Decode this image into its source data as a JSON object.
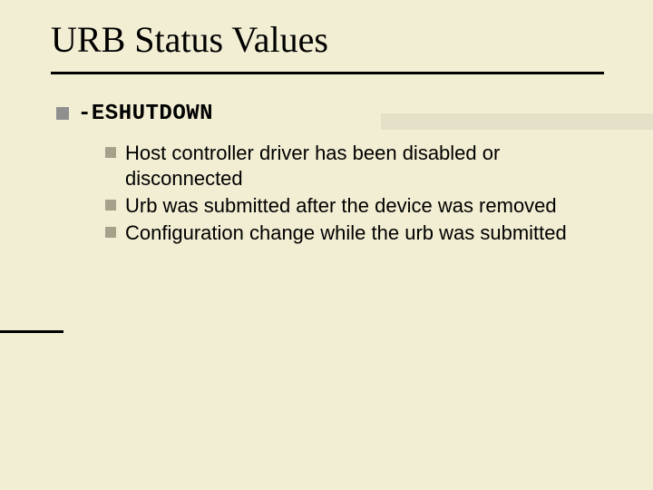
{
  "title": "URB Status Values",
  "status": {
    "code": "-ESHUTDOWN"
  },
  "items": [
    "Host controller driver has been disabled or disconnected",
    "Urb was submitted after the device was removed",
    "Configuration change while the urb was submitted"
  ]
}
